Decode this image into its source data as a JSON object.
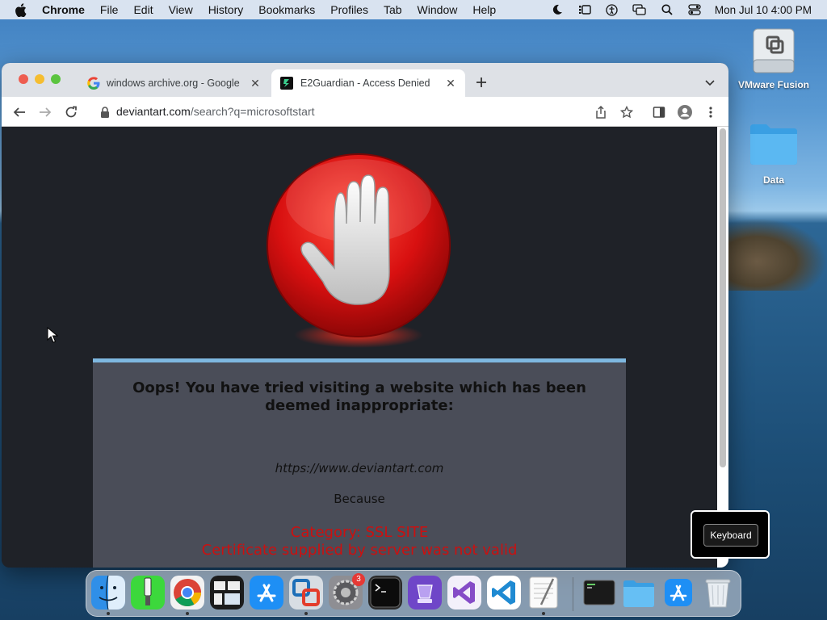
{
  "menubar": {
    "app": "Chrome",
    "items": [
      "File",
      "Edit",
      "View",
      "History",
      "Bookmarks",
      "Profiles",
      "Tab",
      "Window",
      "Help"
    ],
    "clock": "Mon Jul 10  4:00 PM"
  },
  "desktop": {
    "icons": [
      {
        "label": "VMware Fusion",
        "icon": "vmware-drive-icon"
      },
      {
        "label": "Data",
        "icon": "folder-icon"
      }
    ]
  },
  "browser": {
    "tabs": [
      {
        "title": "windows archive.org - Google",
        "favicon": "google-icon",
        "active": false
      },
      {
        "title": "E2Guardian - Access Denied",
        "favicon": "e2guardian-icon",
        "active": true
      }
    ],
    "url": {
      "host": "deviantart.com",
      "path": "/search?q=microsoftstart"
    }
  },
  "blockpage": {
    "headline": "Oops! You have tried visiting a website which has been deemed inappropriate:",
    "site": "https://www.deviantart.com",
    "because": "Because",
    "category": "Category: SSL SITE",
    "reason": "Certificate supplied by server was not valid"
  },
  "keyboard_popup": {
    "label": "Keyboard"
  },
  "dock": {
    "apps": [
      "Finder",
      "Script Editor",
      "Google Chrome",
      "Mission Control",
      "App Store",
      "VMware Fusion",
      "System Preferences",
      "Terminal",
      "Instruments",
      "Visual Studio",
      "Visual Studio Code",
      "TextEdit",
      "Console",
      "Folder",
      "App Store Downloads",
      "Trash"
    ],
    "system_prefs_badge": "3"
  },
  "colors": {
    "accent_red": "#cc1010",
    "panel_border": "#7eb8e0",
    "page_bg": "#1f2228"
  }
}
